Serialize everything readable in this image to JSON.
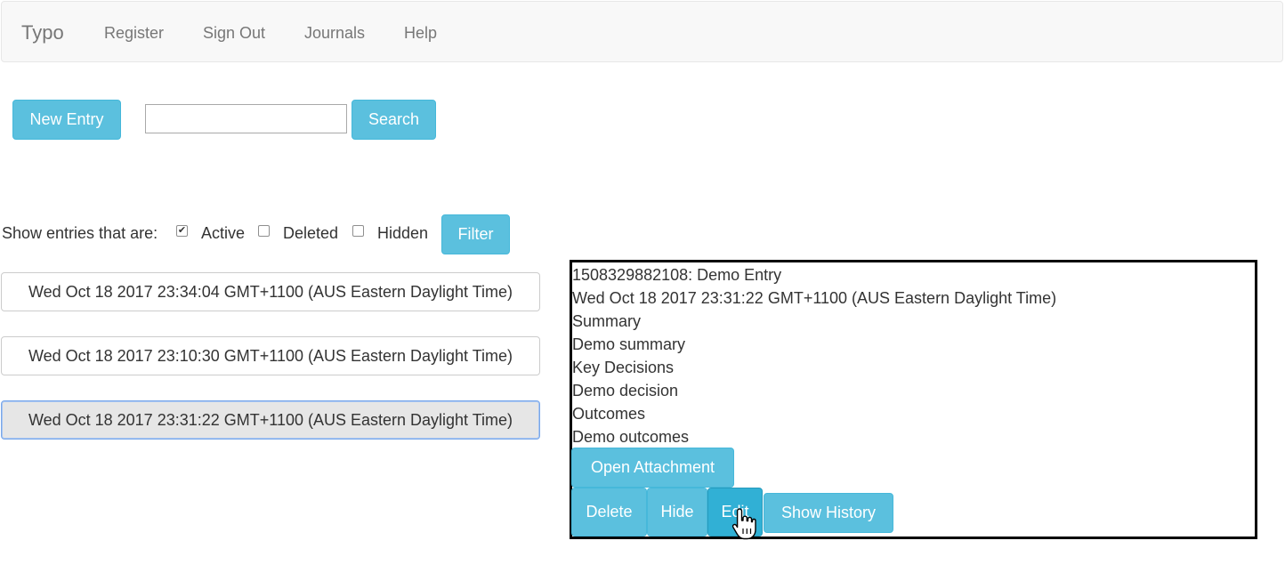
{
  "navbar": {
    "brand": "Typo",
    "links": [
      "Register",
      "Sign Out",
      "Journals",
      "Help"
    ]
  },
  "toolbar": {
    "new_entry_label": "New Entry",
    "search_value": "",
    "search_label": "Search"
  },
  "filter": {
    "prompt": "Show entries that are:",
    "options": [
      {
        "label": "Active",
        "checked": true
      },
      {
        "label": "Deleted",
        "checked": false
      },
      {
        "label": "Hidden",
        "checked": false
      }
    ],
    "button_label": "Filter"
  },
  "entries": [
    {
      "label": "Wed Oct 18 2017 23:34:04 GMT+1100 (AUS Eastern Daylight Time)",
      "selected": false
    },
    {
      "label": "Wed Oct 18 2017 23:10:30 GMT+1100 (AUS Eastern Daylight Time)",
      "selected": false
    },
    {
      "label": "Wed Oct 18 2017 23:31:22 GMT+1100 (AUS Eastern Daylight Time)",
      "selected": true
    }
  ],
  "detail": {
    "title": "1508329882108: Demo Entry",
    "date": "Wed Oct 18 2017 23:31:22 GMT+1100 (AUS Eastern Daylight Time)",
    "summary_heading": "Summary",
    "summary": "Demo summary",
    "decisions_heading": "Key Decisions",
    "decisions": "Demo decision",
    "outcomes_heading": "Outcomes",
    "outcomes": "Demo outcomes",
    "open_attachment_label": "Open Attachment",
    "delete_label": "Delete",
    "hide_label": "Hide",
    "edit_label": "Edit",
    "show_history_label": "Show History"
  },
  "colors": {
    "button": "#5bc0de",
    "button_active": "#31b0d5",
    "navbar_bg": "#f8f8f8"
  },
  "icons": {
    "pointer": "hand-pointer-icon",
    "check": "checkmark-icon"
  }
}
